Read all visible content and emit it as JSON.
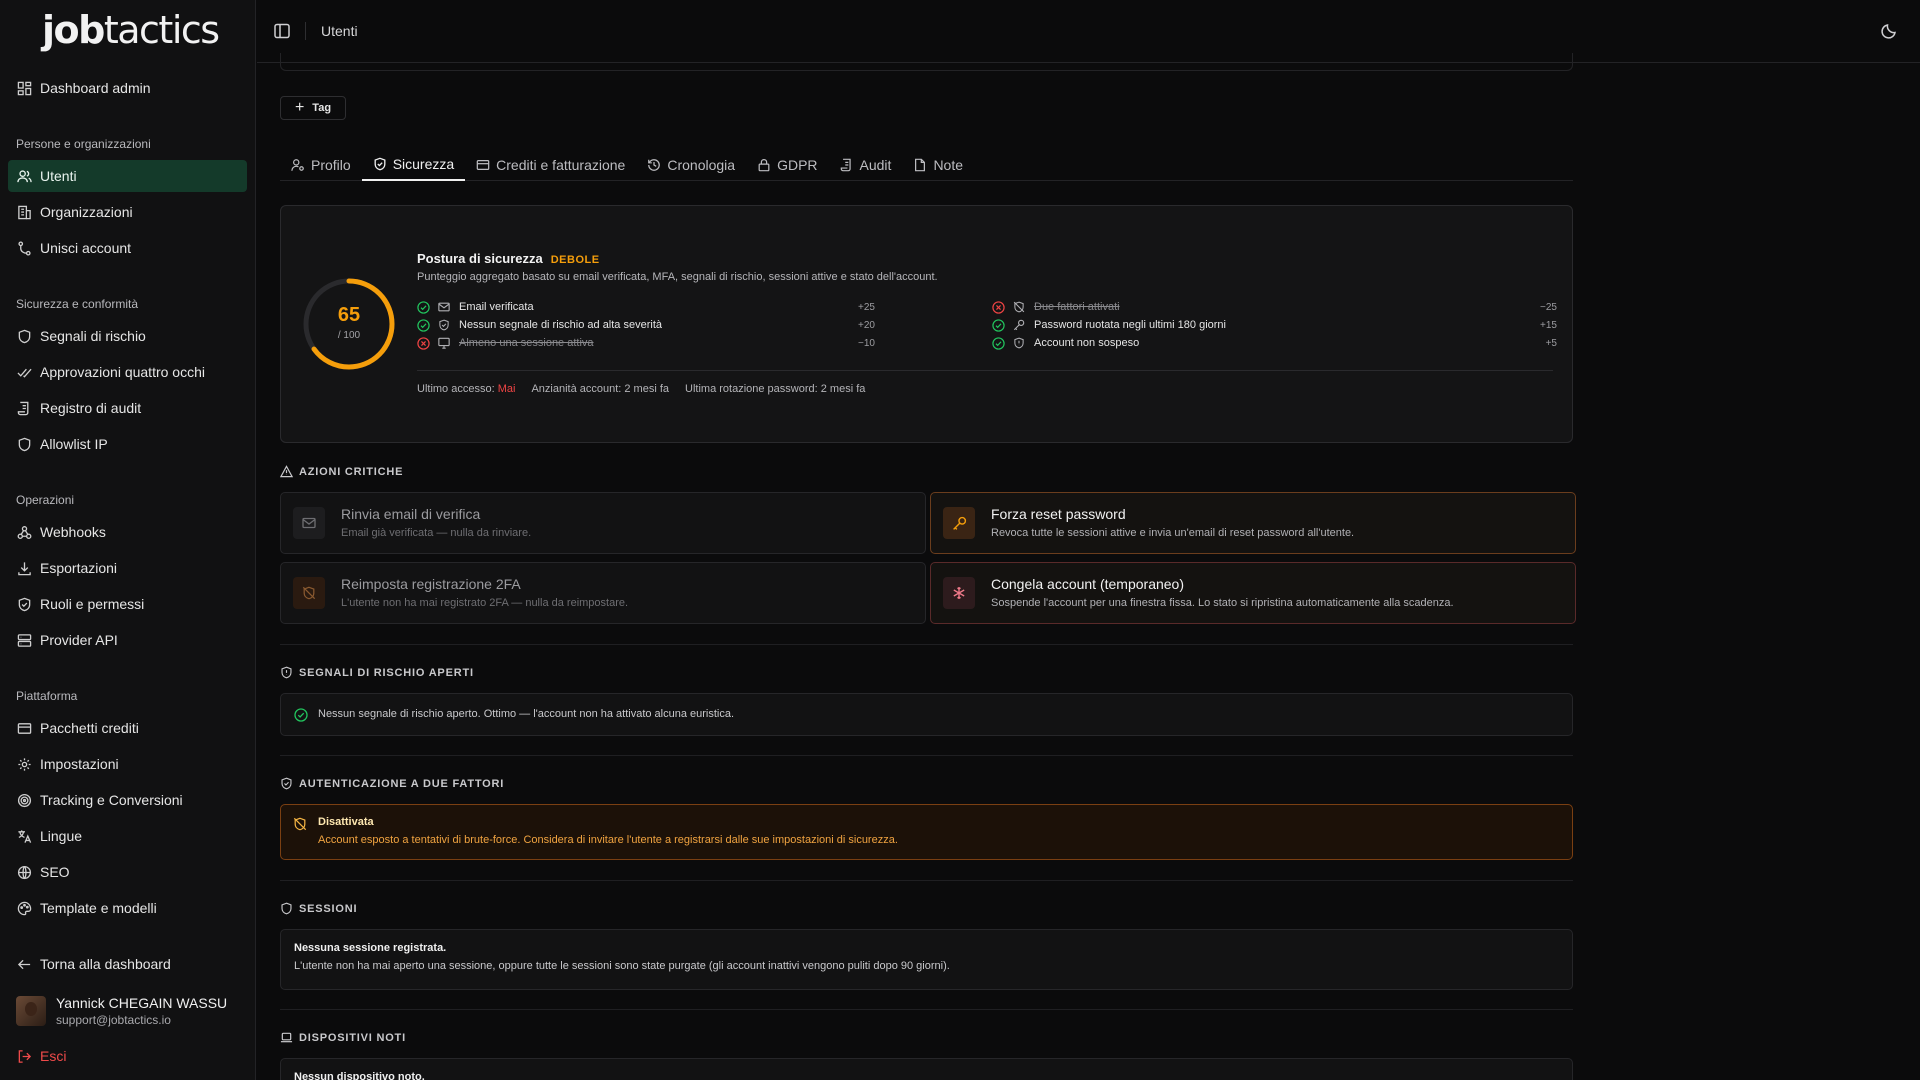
{
  "brand": {
    "logo_bold": "job",
    "logo_rest": "tactics"
  },
  "sidebar": {
    "top_item": "Dashboard admin",
    "sections": [
      {
        "title": "Persone e organizzazioni",
        "items": [
          "Utenti",
          "Organizzazioni",
          "Unisci account"
        ]
      },
      {
        "title": "Sicurezza e conformità",
        "items": [
          "Segnali di rischio",
          "Approvazioni quattro occhi",
          "Registro di audit",
          "Allowlist IP"
        ]
      },
      {
        "title": "Operazioni",
        "items": [
          "Webhooks",
          "Esportazioni",
          "Ruoli e permessi",
          "Provider API"
        ]
      },
      {
        "title": "Piattaforma",
        "items": [
          "Pacchetti crediti",
          "Impostazioni",
          "Tracking e Conversioni",
          "Lingue",
          "SEO",
          "Template e modelli"
        ]
      }
    ],
    "back": "Torna alla dashboard",
    "user": {
      "name": "Yannick CHEGAIN WASSU",
      "email": "support@jobtactics.io"
    },
    "logout": "Esci"
  },
  "topbar": {
    "breadcrumb": "Utenti"
  },
  "main": {
    "tag_button": "Tag",
    "tabs": [
      "Profilo",
      "Sicurezza",
      "Crediti e fatturazione",
      "Cronologia",
      "GDPR",
      "Audit",
      "Note"
    ],
    "active_tab": "Sicurezza",
    "posture": {
      "score": "65",
      "score_max": "/ 100",
      "score_value": 65,
      "title": "Postura di sicurezza",
      "badge": "DEBOLE",
      "description": "Punteggio aggregato basato su email verificata, MFA, segnali di rischio, sessioni attive e stato dell'account.",
      "checks_left": [
        {
          "label": "Email verificata",
          "points": "+25",
          "ok": true
        },
        {
          "label": "Nessun segnale di rischio ad alta severità",
          "points": "+20",
          "ok": true
        },
        {
          "label": "Almeno una sessione attiva",
          "points": "−10",
          "ok": false
        }
      ],
      "checks_right": [
        {
          "label": "Due fattori attivati",
          "points": "−25",
          "ok": false
        },
        {
          "label": "Password ruotata negli ultimi 180 giorni",
          "points": "+15",
          "ok": true
        },
        {
          "label": "Account non sospeso",
          "points": "+5",
          "ok": true
        }
      ],
      "meta": {
        "last_access_label": "Ultimo accesso:",
        "last_access_value": "Mai",
        "seniority": "Anzianità account: 2 mesi fa",
        "rotation": "Ultima rotazione password: 2 mesi fa"
      }
    },
    "critical": {
      "heading": "AZIONI CRITICHE",
      "actions": [
        {
          "title": "Rinvia email di verifica",
          "desc": "Email già verificata — nulla da rinviare."
        },
        {
          "title": "Forza reset password",
          "desc": "Revoca tutte le sessioni attive e invia un'email di reset password all'utente."
        },
        {
          "title": "Reimposta registrazione 2FA",
          "desc": "L'utente non ha mai registrato 2FA — nulla da reimpostare."
        },
        {
          "title": "Congela account (temporaneo)",
          "desc": "Sospende l'account per una finestra fissa. Lo stato si ripristina automaticamente alla scadenza."
        }
      ]
    },
    "risk": {
      "heading": "SEGNALI DI RISCHIO APERTI",
      "message": "Nessun segnale di rischio aperto. Ottimo — l'account non ha attivato alcuna euristica."
    },
    "twofa": {
      "heading": "AUTENTICAZIONE A DUE FATTORI",
      "status": "Disattivata",
      "message": "Account esposto a tentativi di brute-force. Considera di invitare l'utente a registrarsi dalle sue impostazioni di sicurezza."
    },
    "sessions": {
      "heading": "SESSIONI",
      "title": "Nessuna sessione registrata.",
      "message": "L'utente non ha mai aperto una sessione, oppure tutte le sessioni sono state purgate (gli account inattivi vengono puliti dopo 90 giorni)."
    },
    "devices": {
      "heading": "DISPOSITIVI NOTI",
      "title": "Nessun dispositivo noto."
    }
  },
  "colors": {
    "accent_green": "#22c55e",
    "warning": "#f59e0b",
    "danger": "#ef4444",
    "active_nav": "#143a2a"
  }
}
